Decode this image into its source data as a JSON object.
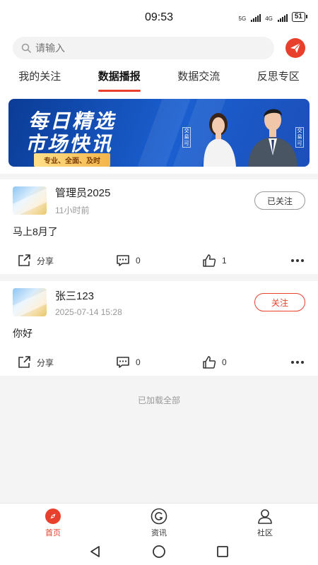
{
  "status": {
    "time": "09:53",
    "net1": "5G",
    "net2": "4G",
    "battery": "51"
  },
  "search": {
    "placeholder": "请输入"
  },
  "tabs": [
    {
      "label": "我的关注"
    },
    {
      "label": "数据播报",
      "active": true
    },
    {
      "label": "数据交流"
    },
    {
      "label": "反思专区"
    }
  ],
  "banner": {
    "line1": "每日精选",
    "line2": "市场快讯",
    "tagline": "专业、全面、及时",
    "badge1": "交易可",
    "badge2": "交易可"
  },
  "posts": [
    {
      "name": "管理员2025",
      "time": "11小时前",
      "follow": "已关注",
      "content": "马上8月了",
      "share": "分享",
      "comments": "0",
      "likes": "1"
    },
    {
      "name": "张三123",
      "time": "2025-07-14 15:28",
      "follow": "关注",
      "content": "你好",
      "share": "分享",
      "comments": "0",
      "likes": "0"
    }
  ],
  "footer_text": "已加载全部",
  "bottom_nav": [
    {
      "label": "首页",
      "icon": "compass-icon",
      "active": true
    },
    {
      "label": "资讯",
      "icon": "news-icon"
    },
    {
      "label": "社区",
      "icon": "person-icon"
    }
  ],
  "colors": {
    "accent": "#e8402d",
    "banner": "#1a5fd0"
  }
}
